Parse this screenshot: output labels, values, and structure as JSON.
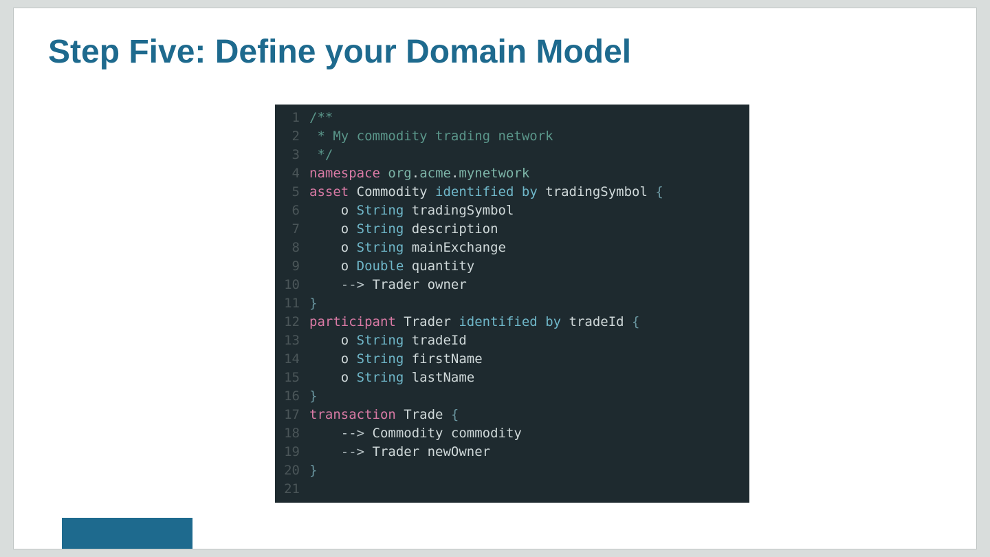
{
  "slide": {
    "title": "Step Five: Define your Domain Model"
  },
  "code": {
    "lines": [
      {
        "n": "1",
        "segs": [
          {
            "c": "cm",
            "t": "/**"
          }
        ]
      },
      {
        "n": "2",
        "segs": [
          {
            "c": "cm",
            "t": " * My commodity trading network"
          }
        ]
      },
      {
        "n": "3",
        "segs": [
          {
            "c": "cm",
            "t": " */"
          }
        ]
      },
      {
        "n": "4",
        "segs": [
          {
            "c": "kw",
            "t": "namespace"
          },
          {
            "c": "id",
            "t": " "
          },
          {
            "c": "pk",
            "t": "org"
          },
          {
            "c": "id",
            "t": "."
          },
          {
            "c": "pk",
            "t": "acme"
          },
          {
            "c": "id",
            "t": "."
          },
          {
            "c": "pk",
            "t": "mynetwork"
          }
        ]
      },
      {
        "n": "5",
        "segs": [
          {
            "c": "kw",
            "t": "asset"
          },
          {
            "c": "id",
            "t": " Commodity "
          },
          {
            "c": "tp",
            "t": "identified by"
          },
          {
            "c": "id",
            "t": " tradingSymbol "
          },
          {
            "c": "br",
            "t": "{"
          }
        ]
      },
      {
        "n": "6",
        "segs": [
          {
            "c": "id",
            "t": "    o "
          },
          {
            "c": "tp",
            "t": "String"
          },
          {
            "c": "id",
            "t": " tradingSymbol"
          }
        ]
      },
      {
        "n": "7",
        "segs": [
          {
            "c": "id",
            "t": "    o "
          },
          {
            "c": "tp",
            "t": "String"
          },
          {
            "c": "id",
            "t": " description"
          }
        ]
      },
      {
        "n": "8",
        "segs": [
          {
            "c": "id",
            "t": "    o "
          },
          {
            "c": "tp",
            "t": "String"
          },
          {
            "c": "id",
            "t": " mainExchange"
          }
        ]
      },
      {
        "n": "9",
        "segs": [
          {
            "c": "id",
            "t": "    o "
          },
          {
            "c": "tp",
            "t": "Double"
          },
          {
            "c": "id",
            "t": " quantity"
          }
        ]
      },
      {
        "n": "10",
        "segs": [
          {
            "c": "id",
            "t": "    "
          },
          {
            "c": "ar",
            "t": "-->"
          },
          {
            "c": "id",
            "t": " Trader owner"
          }
        ]
      },
      {
        "n": "11",
        "segs": [
          {
            "c": "br",
            "t": "}"
          }
        ]
      },
      {
        "n": "12",
        "segs": [
          {
            "c": "kw",
            "t": "participant"
          },
          {
            "c": "id",
            "t": " Trader "
          },
          {
            "c": "tp",
            "t": "identified by"
          },
          {
            "c": "id",
            "t": " tradeId "
          },
          {
            "c": "br",
            "t": "{"
          }
        ]
      },
      {
        "n": "13",
        "segs": [
          {
            "c": "id",
            "t": "    o "
          },
          {
            "c": "tp",
            "t": "String"
          },
          {
            "c": "id",
            "t": " tradeId"
          }
        ]
      },
      {
        "n": "14",
        "segs": [
          {
            "c": "id",
            "t": "    o "
          },
          {
            "c": "tp",
            "t": "String"
          },
          {
            "c": "id",
            "t": " firstName"
          }
        ]
      },
      {
        "n": "15",
        "segs": [
          {
            "c": "id",
            "t": "    o "
          },
          {
            "c": "tp",
            "t": "String"
          },
          {
            "c": "id",
            "t": " lastName"
          }
        ]
      },
      {
        "n": "16",
        "segs": [
          {
            "c": "br",
            "t": "}"
          }
        ]
      },
      {
        "n": "17",
        "segs": [
          {
            "c": "kw",
            "t": "transaction"
          },
          {
            "c": "id",
            "t": " Trade "
          },
          {
            "c": "br",
            "t": "{"
          }
        ]
      },
      {
        "n": "18",
        "segs": [
          {
            "c": "id",
            "t": "    "
          },
          {
            "c": "ar",
            "t": "-->"
          },
          {
            "c": "id",
            "t": " Commodity commodity"
          }
        ]
      },
      {
        "n": "19",
        "segs": [
          {
            "c": "id",
            "t": "    "
          },
          {
            "c": "ar",
            "t": "-->"
          },
          {
            "c": "id",
            "t": " Trader newOwner"
          }
        ]
      },
      {
        "n": "20",
        "segs": [
          {
            "c": "br",
            "t": "}"
          }
        ]
      },
      {
        "n": "21",
        "segs": [
          {
            "c": "id",
            "t": ""
          }
        ]
      }
    ]
  }
}
